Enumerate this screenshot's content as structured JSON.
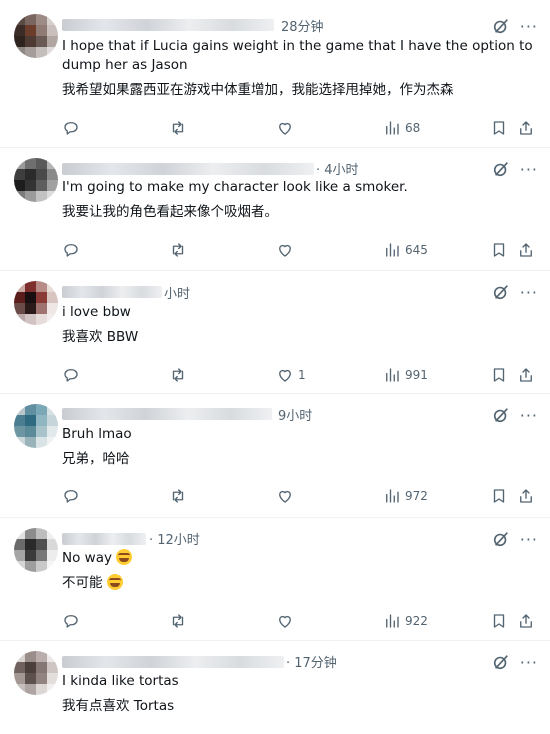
{
  "tweets": [
    {
      "time": "28分钟",
      "text_en": "I hope that if Lucia gains weight in the game that I have the option to dump her as Jason",
      "text_zh": "我希望如果露西亚在游戏中体重增加，我能选择甩掉她，作为杰森",
      "replies": "",
      "retweets": "",
      "likes": "",
      "views": "68",
      "avatar_colors": [
        "#5b4a44",
        "#7a6660",
        "#9c8b86",
        "#d7d0ce",
        "#3c2c28",
        "#6d3d2c",
        "#8f7b74",
        "#c9c0bd",
        "#2f2320",
        "#4d3a33",
        "#6a5a56",
        "#b2a6a2",
        "#8e8885",
        "#a59d9a",
        "#c4bebc",
        "#e0dcdb"
      ]
    },
    {
      "time": "· 4小时",
      "text_en": "I'm going to make my character look like a smoker.",
      "text_zh": "我要让我的角色看起来像个吸烟者。",
      "replies": "",
      "retweets": "",
      "likes": "",
      "views": "645",
      "avatar_colors": [
        "#9a9a9a",
        "#6f6f6f",
        "#5a5a5a",
        "#b5b5b5",
        "#3e3e3e",
        "#2b2b2b",
        "#4a4a4a",
        "#8a8a8a",
        "#1d1d1d",
        "#333333",
        "#5e5e5e",
        "#a0a0a0",
        "#7b7b7b",
        "#9b9b9b",
        "#c2c2c2",
        "#dcdcdc"
      ]
    },
    {
      "time": "小时",
      "text_en": "i love bbw",
      "text_zh": "我喜欢 BBW",
      "replies": "",
      "retweets": "",
      "likes": "1",
      "views": "991",
      "avatar_colors": [
        "#caa9a3",
        "#7e2f2d",
        "#b88c86",
        "#e8dcd9",
        "#5a1d1c",
        "#1a0f10",
        "#8a3b36",
        "#d8c5c1",
        "#6b4b48",
        "#2b1a1a",
        "#9e7370",
        "#efe7e5",
        "#b9a8a6",
        "#d1c3c1",
        "#e6dddb",
        "#f3eeed"
      ]
    },
    {
      "time": "9小时",
      "text_en": "Bruh lmao",
      "text_zh": "兄弟，哈哈",
      "replies": "",
      "retweets": "",
      "likes": "",
      "views": "972",
      "avatar_colors": [
        "#b9c7cb",
        "#5f8fa0",
        "#7ba8b6",
        "#d7e1e3",
        "#4b7e90",
        "#2f6b80",
        "#8fb6c1",
        "#c6d5d9",
        "#6e95a2",
        "#5b8a98",
        "#a9c3ca",
        "#e1e9eb",
        "#cbd6d9",
        "#9ab3ba",
        "#dae3e5",
        "#eef2f3"
      ]
    },
    {
      "time": "· 12小时",
      "text_en": "No way",
      "text_zh": "不可能",
      "replies": "",
      "retweets": "",
      "likes": "",
      "views": "922",
      "avatar_colors": [
        "#e2e2e2",
        "#8c8c8c",
        "#bdbdbd",
        "#f0f0f0",
        "#6a6a6a",
        "#2a2a2a",
        "#4f4f4f",
        "#d9d9d9",
        "#a5a5a5",
        "#3b3b3b",
        "#777777",
        "#ededed",
        "#d4d4d4",
        "#9e9e9e",
        "#c9c9c9",
        "#f5f5f5"
      ]
    },
    {
      "time": "· 17分钟",
      "text_en": "I kinda like tortas",
      "text_zh": "我有点喜欢 Tortas",
      "replies": "",
      "retweets": "",
      "likes": "",
      "views": "",
      "avatar_colors": [
        "#d8d2d0",
        "#9a8d8a",
        "#b9aeab",
        "#ece8e7",
        "#6f625f",
        "#4b3f3c",
        "#857774",
        "#cfc6c4",
        "#a49895",
        "#5d514e",
        "#908380",
        "#e3dddc",
        "#c6bebc",
        "#aea4a2",
        "#dcd6d5",
        "#f1eeed"
      ]
    }
  ]
}
